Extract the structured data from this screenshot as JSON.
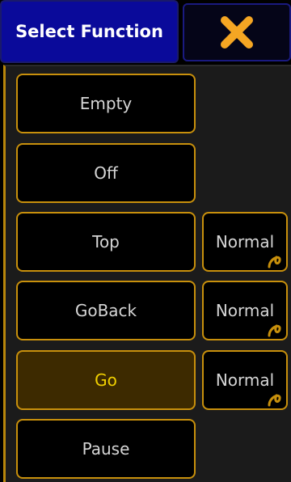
{
  "header": {
    "title": "Select Function"
  },
  "close": {
    "icon": "close-x-icon",
    "color": "#f5a623"
  },
  "functions": [
    {
      "label": "Empty",
      "mode": ""
    },
    {
      "label": "Off",
      "mode": ""
    },
    {
      "label": "Top",
      "mode": "Normal"
    },
    {
      "label": "GoBack",
      "mode": "Normal"
    },
    {
      "label": "Go",
      "mode": "Normal",
      "active": true
    },
    {
      "label": "Pause",
      "mode": ""
    }
  ],
  "colors": {
    "title_bg": "#0a0a9a",
    "accent": "#c8900c",
    "active_bg": "#3d2a00",
    "active_text": "#f0d000"
  }
}
